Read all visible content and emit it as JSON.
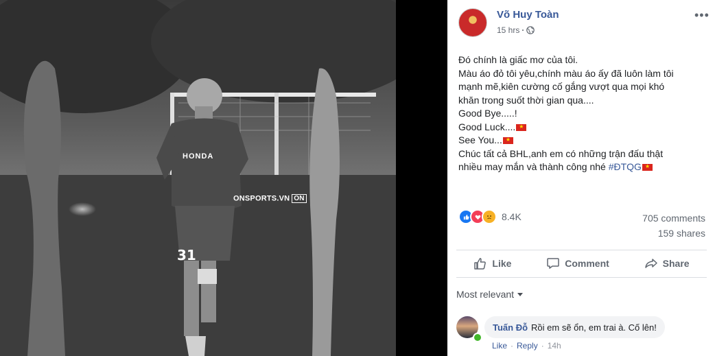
{
  "post": {
    "author": "Võ Huy Toàn",
    "time": "15 hrs",
    "lines": [
      "Đó chính là giấc mơ của tôi.",
      "Màu áo đỏ tôi yêu,chính màu áo ấy đã luôn làm tôi",
      "mạnh mẽ,kiên cường cố gắng vượt qua mọi khó",
      "khăn trong suốt thời gian qua....",
      "Good Bye.....!",
      "Good Luck....",
      "See You...",
      "Chúc tất cả BHL,anh em có những trận đấu thật",
      "nhiều may mắn và thành công nhé "
    ],
    "hashtag": "#ĐTQG"
  },
  "photo": {
    "watermark": "ONSPORTS.VN",
    "watermark_logo": "ON",
    "jersey_number": "31",
    "jersey_brand": "HONDA"
  },
  "stats": {
    "reactions": "8.4K",
    "comments": "705 comments",
    "shares": "159 shares"
  },
  "actions": {
    "like": "Like",
    "comment": "Comment",
    "share": "Share"
  },
  "filter": {
    "label": "Most relevant"
  },
  "comment": {
    "name": "Tuấn Đỗ",
    "text": "Rồi em sẽ ổn, em trai à. Cố lên!",
    "like": "Like",
    "reply": "Reply",
    "time": "14h"
  },
  "icons": {
    "globe": "globe-icon",
    "more": "more-options-icon",
    "like": "thumbs-up-icon",
    "comment": "speech-bubble-icon",
    "share": "share-arrow-icon",
    "caret": "caret-down-icon"
  },
  "colors": {
    "link": "#385898",
    "meta": "#606770",
    "like_blue": "#1877f2",
    "love_red": "#f33e58",
    "sad_yellow": "#f7b125",
    "flag_red": "#da251d"
  }
}
